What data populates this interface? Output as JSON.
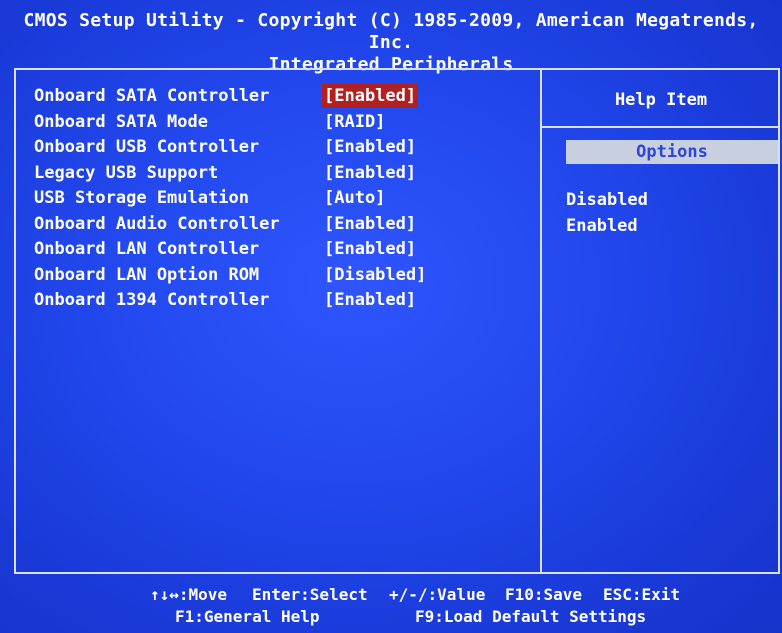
{
  "header": {
    "line1": "CMOS Setup Utility - Copyright (C) 1985-2009, American Megatrends, Inc.",
    "line2": "Integrated Peripherals"
  },
  "settings": [
    {
      "label": "Onboard SATA Controller",
      "value": "[Enabled]",
      "selected": true
    },
    {
      "label": "Onboard SATA Mode",
      "value": "[RAID]"
    },
    {
      "label": "Onboard USB Controller",
      "value": "[Enabled]"
    },
    {
      "label": "Legacy USB Support",
      "value": "[Enabled]"
    },
    {
      "label": "USB Storage Emulation",
      "value": "[Auto]"
    },
    {
      "label": "Onboard Audio Controller",
      "value": "[Enabled]"
    },
    {
      "label": "Onboard LAN Controller",
      "value": "[Enabled]"
    },
    {
      "label": "Onboard LAN Option ROM",
      "value": "[Disabled]"
    },
    {
      "label": "Onboard 1394 Controller",
      "value": "[Enabled]"
    }
  ],
  "help": {
    "title": "Help Item",
    "options_label": "Options",
    "options": [
      "Disabled",
      "Enabled"
    ]
  },
  "footer": {
    "move": "↑↓↔:Move",
    "enter": "Enter:Select",
    "value": "+/-/:Value",
    "save": "F10:Save",
    "exit": "ESC:Exit",
    "help": "F1:General Help",
    "defaults": "F9:Load Default Settings"
  },
  "colors": {
    "background": "#1f3fd9",
    "selected_value_bg": "#b32020",
    "options_bar_bg": "#c8d0e0",
    "options_bar_text": "#2b46d6"
  }
}
